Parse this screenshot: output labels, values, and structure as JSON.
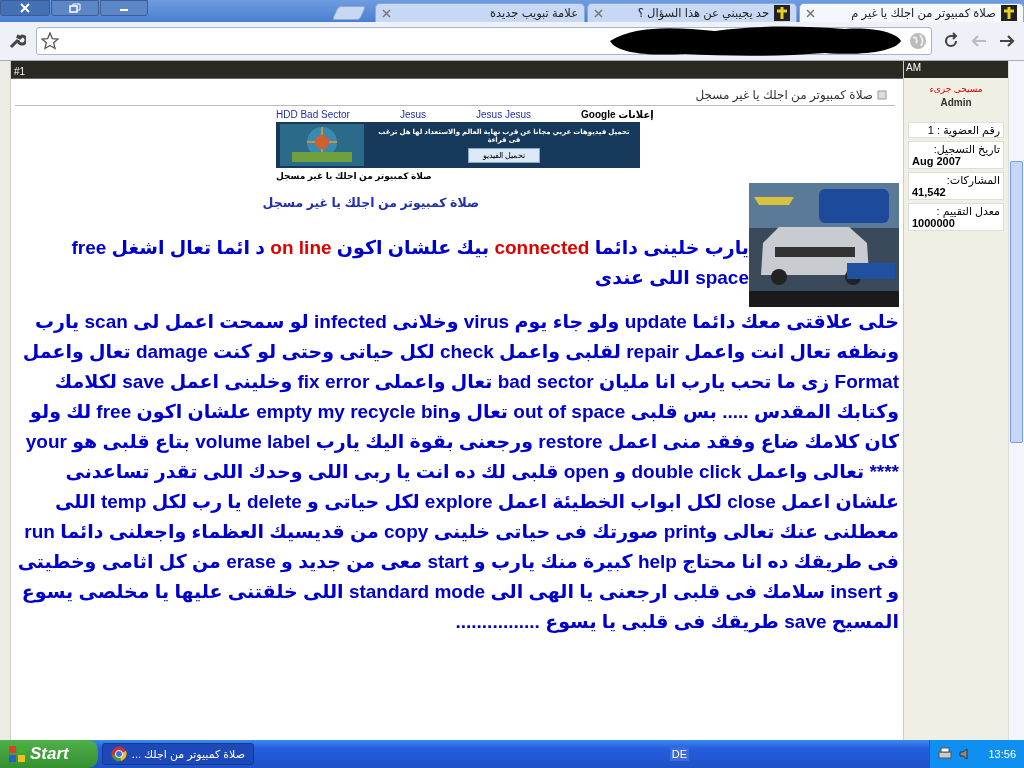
{
  "tabs": [
    {
      "title": "صلاة كمبيوتر من اجلك يا غير م",
      "selected": true
    },
    {
      "title": "حد يجيبني عن هذا السؤال ؟",
      "selected": false
    },
    {
      "title": "علامة تبويب جديدة",
      "selected": false
    }
  ],
  "post": {
    "number": "#1",
    "time": "AM",
    "title": "صلاة كمبيوتر من اجلك يا غير مسجل",
    "ad_links": [
      "إعلانات Google",
      "Jesus Jesus",
      "Jesus",
      "HDD Bad Sector"
    ],
    "banner": {
      "text": "تحميل فيديوهات عربي مجانا عن قرب نهاية العالم والاستعداد لها  هل ترغب فى قراءة",
      "button": "تحميل الفيديو"
    },
    "caption": "صلاة كمبيوتر من اجلك يا غير مسجل",
    "heading": "صلاة كمبيوتر من اجلك يا غير مسجل",
    "paragraphs": [
      [
        {
          "t": "يارب خلينى دائما ",
          "kind": "plain"
        },
        {
          "t": "connected",
          "kind": "red"
        },
        {
          "t": " بيك علشان اكون ",
          "kind": "plain"
        },
        {
          "t": "on line",
          "kind": "red"
        },
        {
          "t": " د ائما تعال اشغل free space اللى عندى",
          "kind": "plain"
        }
      ],
      [
        {
          "t": "خلى علاقتى معك دائما update ولو جاء يوم virus وخلانى infected لو سمحت اعمل لى scan يارب ونظفه تعال انت واعمل repair لقلبى واعمل check لكل حياتى وحتى لو كنت damage تعال واعمل",
          "kind": "plain"
        }
      ],
      [
        {
          "t": "Format زى ما تحب يارب انا مليان bad sector تعال واعملى fix error وخلينى اعمل save لكلامك وكتابك المقدس ..... بس قلبى out of space تعال وempty my recycle bin علشان اكون free لك ولو كان كلامك ضاع وفقد منى اعمل restore ورجعنى بقوة اليك يارب volume label بتاع قلبى هو your **** تعالى واعمل double click و open قلبى لك ده انت يا ربى اللى وحدك اللى تقدر تساعدنى علشان اعمل close لكل ابواب الخطيئة اعمل explore لكل حياتى و delete يا رب لكل temp اللى معطلنى عنك تعالى وprint صورتك فى حياتى خلينى copy من قديسيك العظماء واجعلنى دائما run فى طريقك ده انا محتاج help كبيرة منك يارب و start معى من جديد و erase من كل اثامى وخطيتى و insert سلامك فى قلبى ارجعنى يا الهى الى standard mode اللى خلقتنى عليها يا مخلصى يسوع المسيح save طريقك فى قلبى يا يسوع ................",
          "kind": "plain"
        }
      ]
    ]
  },
  "user": {
    "name": "مسيحى جرىء",
    "role": "Admin",
    "stats": [
      {
        "label": "رقم العضوية :",
        "value": "1",
        "kind": "inline"
      },
      {
        "label": "تاريخ التسجيل:",
        "value": "Aug 2007",
        "kind": "stacked"
      },
      {
        "label": "المشاركات:",
        "value": "41,542",
        "kind": "stacked"
      },
      {
        "label": "معدل التقييم :",
        "value": "1000000",
        "kind": "stacked"
      }
    ]
  },
  "taskbar": {
    "start": "Start",
    "task": "صلاة كمبيوتر من اجلك ...",
    "language": "DE",
    "clock": "13:56"
  }
}
